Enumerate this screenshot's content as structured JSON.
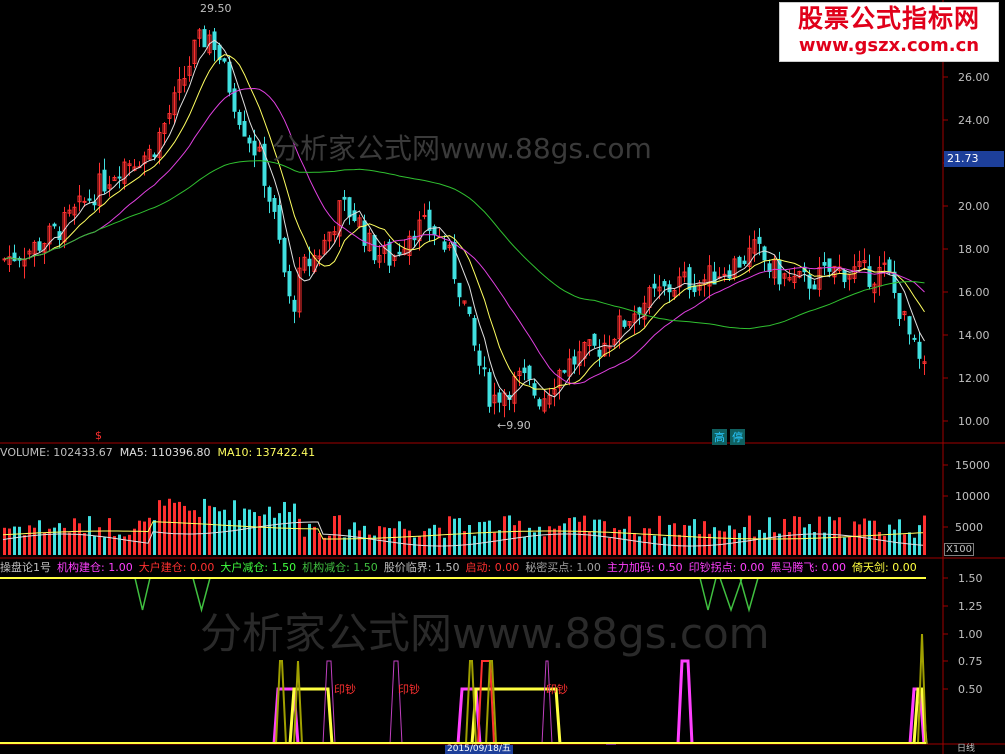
{
  "logo": {
    "line1": "股票公式指标网",
    "line2": "www.gszx.com.cn"
  },
  "watermark": "分析家公式网www.88gs.com",
  "current_price": "21.73",
  "price_axis": [
    "26.00",
    "24.00",
    "22.00",
    "20.00",
    "18.00",
    "16.00",
    "14.00",
    "12.00",
    "10.00"
  ],
  "annotations": {
    "high": "29.50",
    "low": "←9.90",
    "dollar": "$",
    "gaoting": [
      "高",
      "停"
    ]
  },
  "volume_legend": {
    "volume": "VOLUME: 102433.67",
    "ma5": "MA5: 110396.80",
    "ma10": "MA10: 137422.41"
  },
  "volume_axis": [
    "15000",
    "10000",
    "5000"
  ],
  "volume_unit": "X100",
  "indicator_legend": [
    {
      "text": "操盘论1号",
      "color": "#c0c0c0"
    },
    {
      "text": "机构建仓: 1.00",
      "color": "#ff40ff"
    },
    {
      "text": "大户建仓: 0.00",
      "color": "#ff3030"
    },
    {
      "text": "大户减仓: 1.50",
      "color": "#40ff40"
    },
    {
      "text": "机构减仓: 1.50",
      "color": "#40c040"
    },
    {
      "text": "股价临界: 1.50",
      "color": "#c0c0c0"
    },
    {
      "text": "启动: 0.00",
      "color": "#ff3030"
    },
    {
      "text": "秘密买点: 1.00",
      "color": "#a0a0a0"
    },
    {
      "text": "主力加码: 0.50",
      "color": "#ff40ff"
    },
    {
      "text": "印钞拐点: 0.00",
      "color": "#ff40ff"
    },
    {
      "text": "黑马腾飞: 0.00",
      "color": "#ff40ff"
    },
    {
      "text": "倚天剑: 0.00",
      "color": "#ffff40"
    }
  ],
  "indicator_axis": [
    "1.50",
    "1.25",
    "1.00",
    "0.75",
    "0.50"
  ],
  "yinchao_labels": [
    "印钞",
    "印钞",
    "印钞"
  ],
  "date_label": "2015/09/18/五",
  "bottom_axis_tail": "日线",
  "colors": {
    "up": "#ff3030",
    "down": "#40e0e0",
    "ma_white": "#e0e0e0",
    "ma_yellow": "#ffff60",
    "ma_magenta": "#e040e0",
    "ma_green": "#30c030",
    "grid": "#800000"
  }
}
